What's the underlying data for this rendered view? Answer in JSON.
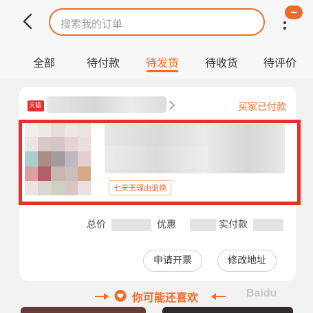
{
  "search": {
    "placeholder": "搜索我的订单"
  },
  "tabs": [
    {
      "label": "全部"
    },
    {
      "label": "待付款"
    },
    {
      "label": "待发货"
    },
    {
      "label": "待收货"
    },
    {
      "label": "待评价"
    }
  ],
  "active_tab": "待发货",
  "order": {
    "shop_badge": "天猫",
    "status": "买家已付款",
    "tag": "七天无理由退换",
    "total_label": "总价",
    "discount_label": "优惠",
    "paid_label": "实付款"
  },
  "actions": {
    "invoice": "申请开票",
    "address": "修改地址"
  },
  "recommend": {
    "title": "你可能还喜欢"
  },
  "watermark": "Baidu",
  "colors": {
    "accent": "#f26a25",
    "highlight": "#ee2c2c"
  }
}
